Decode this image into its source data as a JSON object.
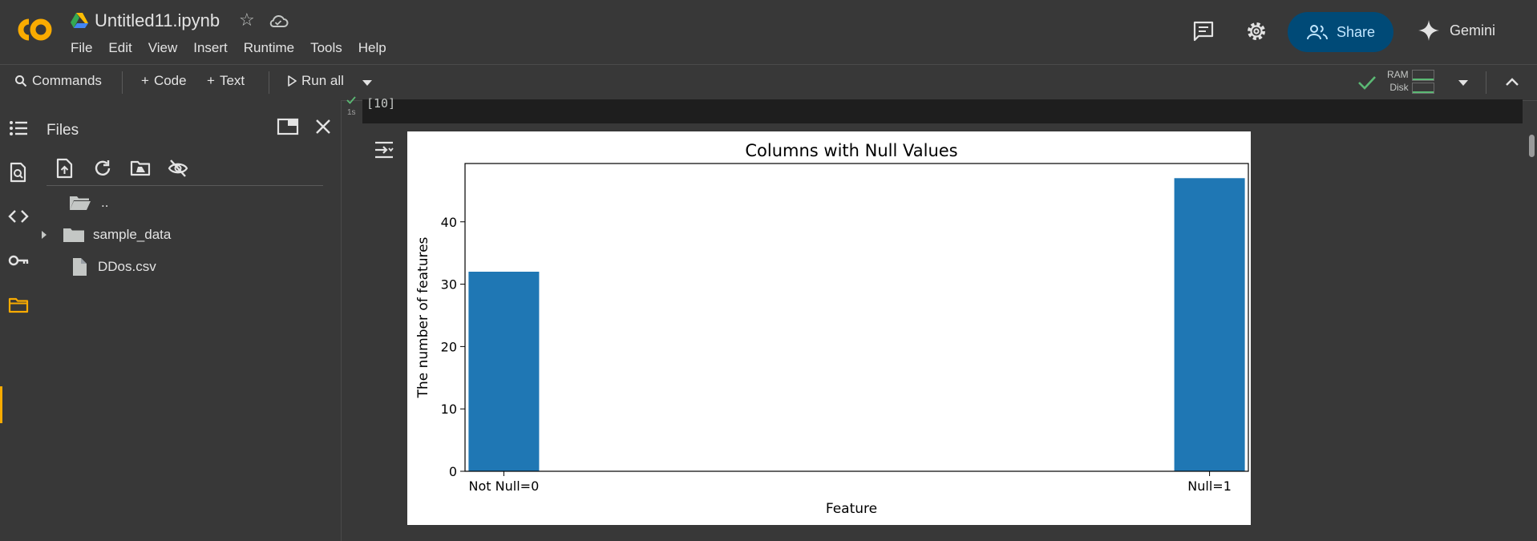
{
  "header": {
    "notebook_title": "Untitled11.ipynb",
    "menu": [
      "File",
      "Edit",
      "View",
      "Insert",
      "Runtime",
      "Tools",
      "Help"
    ],
    "share_label": "Share",
    "gemini_label": "Gemini"
  },
  "toolbar": {
    "commands_label": "Commands",
    "code_label": "Code",
    "text_label": "Text",
    "run_all_label": "Run all",
    "ram_label": "RAM",
    "disk_label": "Disk"
  },
  "files_panel": {
    "title": "Files",
    "items": [
      {
        "name": "..",
        "type": "folder-parent"
      },
      {
        "name": "sample_data",
        "type": "folder"
      },
      {
        "name": "DDos.csv",
        "type": "file"
      }
    ]
  },
  "cell": {
    "execution_count": "[10]",
    "exec_time": "1s"
  },
  "colors": {
    "accent": "#004a77",
    "bar": "#1f77b4",
    "active_rail": "#f9ab00",
    "success": "#5bb974"
  },
  "chart_data": {
    "type": "bar",
    "title": "Columns with Null Values",
    "xlabel": "Feature",
    "ylabel": "The number of features",
    "categories": [
      "Not Null=0",
      "Null=1"
    ],
    "x": [
      0,
      1
    ],
    "values": [
      32,
      47
    ],
    "ylim": [
      0,
      49.35
    ],
    "xlim": [
      -0.055,
      1.055
    ],
    "yticks": [
      0,
      10,
      20,
      30,
      40
    ],
    "grid": false
  }
}
